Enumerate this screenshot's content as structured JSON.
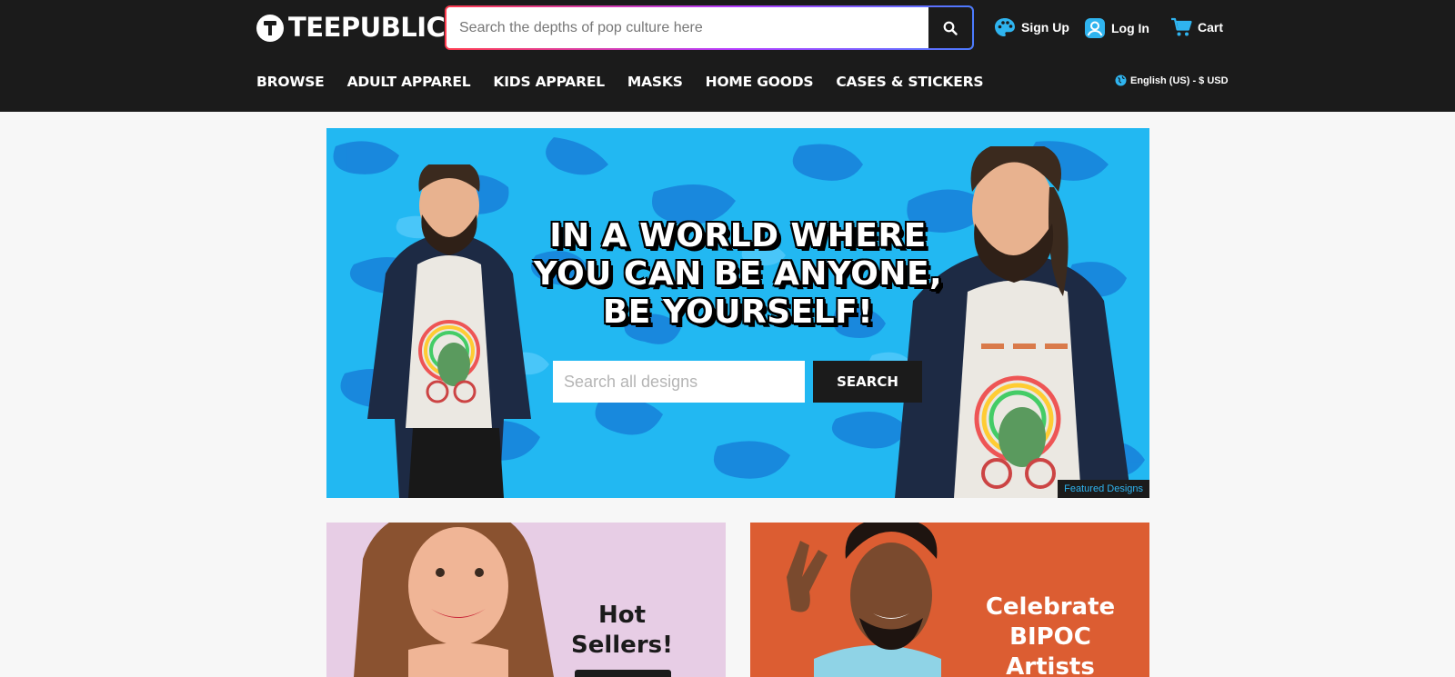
{
  "header": {
    "logo_text": "TEEPUBLIC",
    "search_placeholder": "Search the depths of pop culture here",
    "signup_label": "Sign Up",
    "login_label": "Log In",
    "cart_label": "Cart",
    "locale_label": "English (US) - $ USD"
  },
  "nav": [
    "BROWSE",
    "ADULT APPAREL",
    "KIDS APPAREL",
    "MASKS",
    "HOME GOODS",
    "CASES & STICKERS"
  ],
  "hero": {
    "title_lines": [
      "IN A WORLD WHERE",
      "YOU CAN BE ANYONE,",
      "BE YOURSELF!"
    ],
    "search_placeholder": "Search all designs",
    "search_button": "SEARCH",
    "featured_label": "Featured Designs"
  },
  "promos": {
    "left_lines": [
      "Hot",
      "Sellers!"
    ],
    "right_lines": [
      "Celebrate",
      "BIPOC",
      "Artists"
    ]
  },
  "colors": {
    "header_bg": "#1b1b1b",
    "hero_bg": "#22b8f2",
    "accent_blue": "#2fb4ef",
    "promo_left_bg": "#e7cde5",
    "promo_right_bg": "#dc5d32"
  },
  "icons": {
    "search": "search-icon",
    "signup": "palette-icon",
    "login": "user-icon",
    "cart": "cart-icon",
    "locale": "globe-icon"
  }
}
